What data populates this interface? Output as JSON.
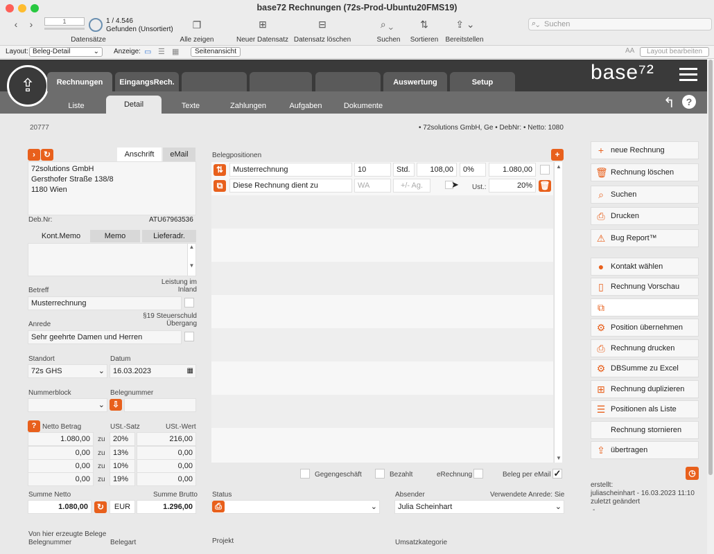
{
  "window": {
    "title": "base72 Rechnungen (72s-Prod-Ubuntu20FMS19)"
  },
  "toolbar": {
    "record_input": "1",
    "record_count": "1 / 4.546",
    "record_status": "Gefunden (Unsortiert)",
    "records_label": "Datensätze",
    "show_all": "Alle zeigen",
    "new_record": "Neuer Datensatz",
    "delete_record": "Datensatz löschen",
    "search": "Suchen",
    "sort": "Sortieren",
    "share": "Bereitstellen",
    "search_placeholder": "Suchen"
  },
  "layoutbar": {
    "layout_label": "Layout:",
    "layout_value": "Beleg-Detail",
    "view_label": "Anzeige:",
    "page_view": "Seitenansicht",
    "edit_layout": "Layout bearbeiten",
    "font_icon": "AA"
  },
  "brand": {
    "logo": "base⁷²"
  },
  "tabs": [
    "Rechnungen",
    "EingangsRech.",
    "",
    "",
    "",
    "Auswertung",
    "Setup"
  ],
  "subtabs": [
    "Liste",
    "Detail",
    "Texte",
    "Zahlungen",
    "Aufgaben",
    "Dokumente"
  ],
  "header": {
    "record_id": "20777",
    "summary": "• 72solutions GmbH, Ge • DebNr:  • Netto: 1080"
  },
  "address": {
    "tab_anschrift": "Anschrift",
    "tab_email": "eMail",
    "line1": "72solutions GmbH",
    "line2": "Gersthofer Straße 138/8",
    "line3": "1180 Wien",
    "deb_label": "Deb.Nr:",
    "uid": "ATU67963536"
  },
  "memo": {
    "tabs": [
      "Kont.Memo",
      "Memo",
      "Lieferadr."
    ]
  },
  "form": {
    "betreff_label": "Betreff",
    "leistung_label": "Leistung im Inland",
    "betreff": "Musterrechnung",
    "steuer_label": "§19 Steuerschuld Übergang",
    "anrede_label": "Anrede",
    "anrede": "Sehr geehrte Damen und Herren",
    "standort_label": "Standort",
    "standort": "72s GHS",
    "datum_label": "Datum",
    "datum": "16.03.2023",
    "nummernblock_label": "Nummerblock",
    "belegnummer_label": "Belegnummer"
  },
  "tax": {
    "netto_label": "Netto Betrag",
    "satz_label": "USt.-Satz",
    "wert_label": "USt.-Wert",
    "rows": [
      {
        "netto": "1.080,00",
        "zu": "zu",
        "satz": "20%",
        "wert": "216,00"
      },
      {
        "netto": "0,00",
        "zu": "zu",
        "satz": "13%",
        "wert": "0,00"
      },
      {
        "netto": "0,00",
        "zu": "zu",
        "satz": "10%",
        "wert": "0,00"
      },
      {
        "netto": "0,00",
        "zu": "zu",
        "satz": "19%",
        "wert": "0,00"
      }
    ],
    "sum_netto_label": "Summe Netto",
    "sum_brutto_label": "Summe Brutto",
    "sum_netto": "1.080,00",
    "currency": "EUR",
    "sum_brutto": "1.296,00"
  },
  "bottom_left": {
    "label1": "Von hier erzeugte Belege",
    "label2": "Belegnummer",
    "label3": "Belegart"
  },
  "positions": {
    "label": "Belegpositionen",
    "row1": {
      "text": "Musterrechnung",
      "qty": "10",
      "unit": "Std.",
      "price": "108,00",
      "discount": "0%",
      "total": "1.080,00"
    },
    "row2": {
      "text": "Diese Rechnung dient zu",
      "unit_ph": "WA",
      "ag_ph": "+/- Ag.",
      "ust_label": "Ust.:",
      "ust": "20%"
    }
  },
  "flags": {
    "gegengeschaeft": "Gegengeschäft",
    "bezahlt": "Bezahlt",
    "erechnung": "eRechnung",
    "beleg_email": "Beleg per eMail"
  },
  "status": {
    "status_label": "Status",
    "absender_label": "Absender",
    "anrede_used_label": "Verwendete Anrede: Sie",
    "absender": "Julia Scheinhart",
    "projekt_label": "Projekt",
    "umsatz_label": "Umsatzkategorie"
  },
  "actions": [
    "neue Rechnung",
    "Rechnung löschen",
    "Suchen",
    "Drucken",
    "Bug Report™",
    "Kontakt wählen",
    "Rechnung Vorschau",
    "",
    "Position übernehmen",
    "Rechnung drucken",
    "DBSumme zu Excel",
    "Rechnung duplizieren",
    "Positionen als Liste",
    "Rechnung stornieren",
    "übertragen"
  ],
  "meta": {
    "erstellt_label": "erstellt:",
    "erstellt": "juliascheinhart - 16.03.2023 11:10",
    "geaendert_label": "zuletzt geändert",
    "geaendert": "-"
  }
}
